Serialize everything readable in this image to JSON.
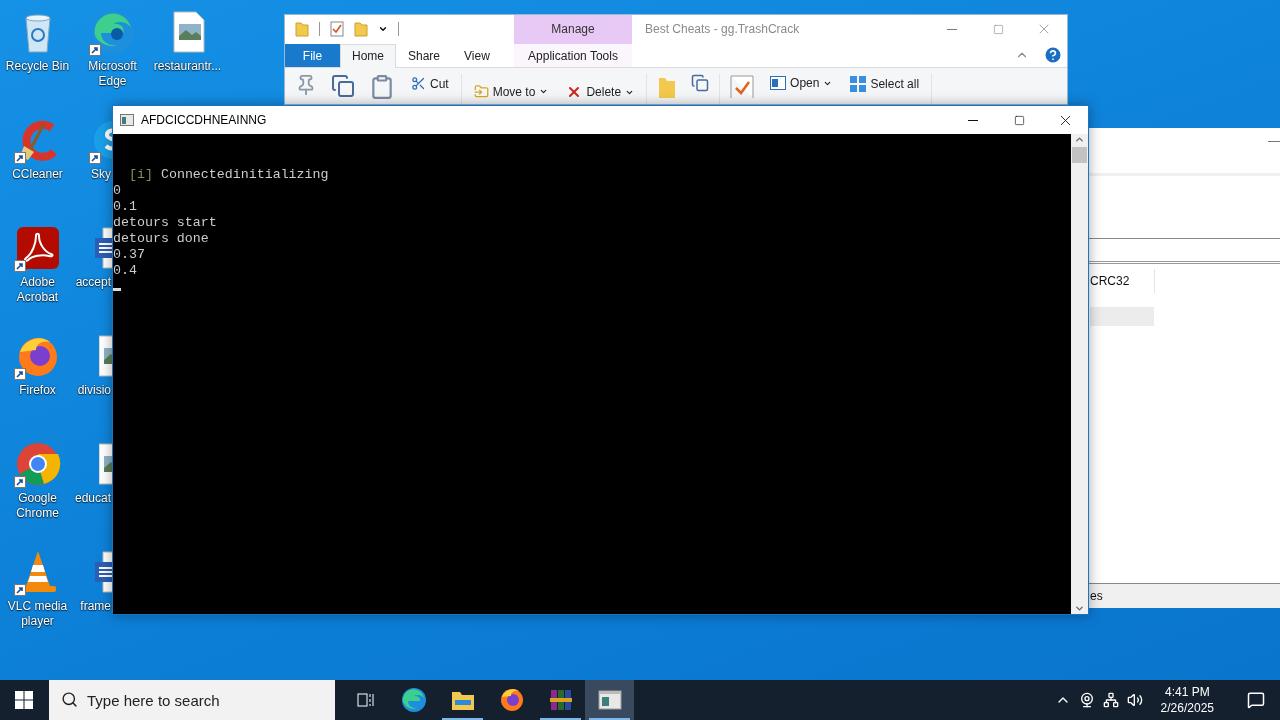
{
  "desktop": {
    "columns": [
      [
        {
          "label": "Recycle Bin",
          "kind": "recycle",
          "shortcut": false
        },
        {
          "label": "CCleaner",
          "kind": "ccleaner",
          "shortcut": true
        },
        {
          "label": "Adobe Acrobat",
          "kind": "acrobat",
          "shortcut": true
        },
        {
          "label": "Firefox",
          "kind": "firefox",
          "shortcut": true
        },
        {
          "label": "Google Chrome",
          "kind": "chrome",
          "shortcut": true
        },
        {
          "label": "VLC media player",
          "kind": "vlc",
          "shortcut": true
        }
      ],
      [
        {
          "label": "Microsoft Edge",
          "kind": "edge",
          "shortcut": true
        },
        {
          "label": "Sky",
          "kind": "skype",
          "shortcut": true
        },
        {
          "label": "accept",
          "kind": "word",
          "shortcut": false
        },
        {
          "label": "divisio",
          "kind": "image",
          "shortcut": false
        },
        {
          "label": "educat",
          "kind": "image",
          "shortcut": false
        },
        {
          "label": "frame",
          "kind": "word",
          "shortcut": false
        }
      ],
      [
        {
          "label": "restaurantr...",
          "kind": "image",
          "shortcut": false
        }
      ]
    ]
  },
  "side_window": {
    "column_header": "CRC32",
    "status_text": "es"
  },
  "explorer": {
    "title": "Best Cheats - gg.TrashCrack",
    "context_group": "Manage",
    "tabs": [
      {
        "label": "File",
        "kind": "file",
        "selected": false
      },
      {
        "label": "Home",
        "kind": "tab",
        "selected": true
      },
      {
        "label": "Share",
        "kind": "tab",
        "selected": false
      },
      {
        "label": "View",
        "kind": "tab",
        "selected": false
      },
      {
        "label": "Application Tools",
        "kind": "context",
        "selected": false
      }
    ],
    "commands": [
      {
        "label": "Cut",
        "kind": "cut",
        "dropdown": false
      },
      {
        "label": "Move to",
        "kind": "move",
        "dropdown": true
      },
      {
        "label": "Delete",
        "kind": "delete",
        "dropdown": true
      },
      {
        "label": "Open",
        "kind": "open",
        "dropdown": true
      },
      {
        "label": "Select all",
        "kind": "select",
        "dropdown": false
      }
    ]
  },
  "console": {
    "title": "AFDCICCDHNEAINNG",
    "lines": [
      {
        "tag": "[i]",
        "text": "Connectedinitializing"
      },
      {
        "text": "0"
      },
      {
        "text": "0.1"
      },
      {
        "text": "detours start"
      },
      {
        "text": "detours done"
      },
      {
        "text": "0.37"
      },
      {
        "text": "0.4"
      }
    ],
    "cursor": true
  },
  "taskbar": {
    "search": {
      "placeholder": "Type here to search"
    },
    "apps": [
      {
        "kind": "taskview",
        "running": false,
        "selected": false
      },
      {
        "kind": "edge",
        "running": false,
        "selected": false
      },
      {
        "kind": "explorer",
        "running": true,
        "selected": false
      },
      {
        "kind": "firefox",
        "running": false,
        "selected": false
      },
      {
        "kind": "winrar",
        "running": true,
        "selected": false
      },
      {
        "kind": "console",
        "running": true,
        "selected": true
      }
    ],
    "clock": {
      "time": "4:41 PM",
      "date": "2/26/2025"
    }
  }
}
